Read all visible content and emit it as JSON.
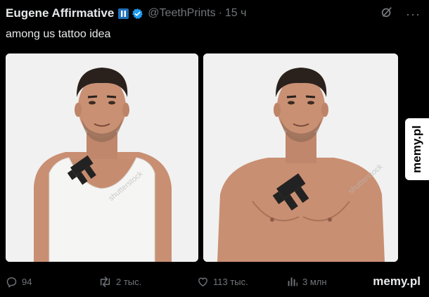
{
  "tweet": {
    "display_name": "Eugene Affirmative",
    "handle": "@TeethPrints",
    "separator": "·",
    "time": "15 ч",
    "text": "among us tattoo idea",
    "more_label": "···"
  },
  "media": [
    {
      "description": "Man in white tank top with a crewmate-shaped tattoo on chest",
      "watermark": "shutterstock"
    },
    {
      "description": "Shirtless man with a crewmate-shaped tattoo on chest",
      "watermark": "shutterstock"
    }
  ],
  "watermarks": {
    "side": "memy.pl",
    "bottom": "memy.pl"
  },
  "actions": {
    "reply_count": "94",
    "retweet_count": "2 тыс.",
    "like_count": "113 тыс.",
    "views_count": "3 млн"
  },
  "colors": {
    "background": "#000000",
    "text": "#e7e9ea",
    "muted": "#71767b",
    "verified": "#1d9bf0",
    "badge": "#1d6fb8"
  },
  "icons": [
    "pause-badge-icon",
    "verified-icon",
    "grok-icon",
    "more-icon",
    "reply-icon",
    "retweet-icon",
    "like-icon",
    "views-icon"
  ]
}
